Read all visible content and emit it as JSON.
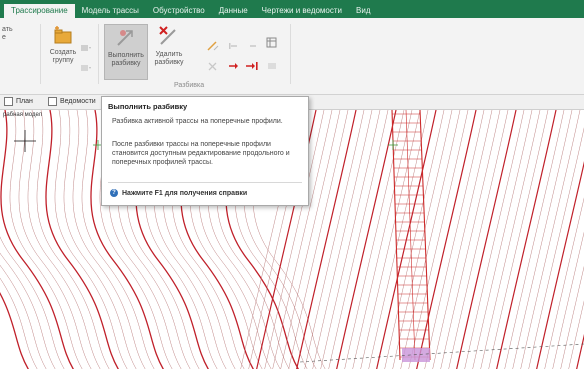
{
  "tabs": [
    {
      "label": "Трассирование"
    },
    {
      "label": "Модель трассы"
    },
    {
      "label": "Обустройство"
    },
    {
      "label": "Данные"
    },
    {
      "label": "Чертежи и ведомости"
    },
    {
      "label": "Вид"
    }
  ],
  "ribbon": {
    "left_cut": "ать\nе",
    "create_group": "Создать\nгруппу",
    "execute_split": "Выполнить\nразбивку",
    "delete_split": "Удалить\nразбивку",
    "group_label": "Разбивка"
  },
  "viewtabs": {
    "plan": "План",
    "statements": "Ведомости",
    "active_command": "Выполнить разбивку"
  },
  "canvas": {
    "view_label": "рабная модел"
  },
  "tooltip": {
    "title": "Выполнить разбивку",
    "p1": "Разбивка активной трассы на поперечные профили.",
    "p2": "После разбивки трассы на поперечные профили становится доступным редактирование продольного и поперечных профилей трассы.",
    "help": "Нажмите F1 для получения справки"
  },
  "colors": {
    "tab_bar": "#1f7a4d",
    "contour_major": "#c0202a",
    "contour_minor": "#b87878",
    "grid_red": "#cc2a2a"
  }
}
